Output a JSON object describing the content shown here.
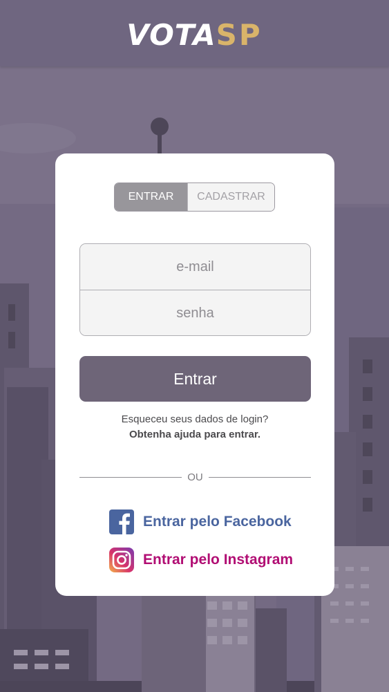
{
  "header": {
    "logo_vota": "VOTA",
    "logo_sp": "SP"
  },
  "auth_tabs": {
    "login": "ENTRAR",
    "register": "CADASTRAR",
    "active": "login"
  },
  "form": {
    "email_placeholder": "e-mail",
    "password_placeholder": "senha",
    "submit_label": "Entrar"
  },
  "help": {
    "question": "Esqueceu seus dados de login?",
    "link": "Obtenha ajuda para entrar."
  },
  "divider": {
    "label": "OU"
  },
  "social": {
    "facebook": {
      "label": "Entrar pelo Facebook",
      "icon": "facebook-icon",
      "color": "#4a659f"
    },
    "instagram": {
      "label": "Entrar pelo Instagram",
      "icon": "instagram-icon",
      "color": "#b10d73"
    }
  },
  "colors": {
    "header_bg": "#6f6680",
    "accent": "#d9b46a",
    "primary_button": "#6e6578",
    "card_bg": "#ffffff"
  }
}
